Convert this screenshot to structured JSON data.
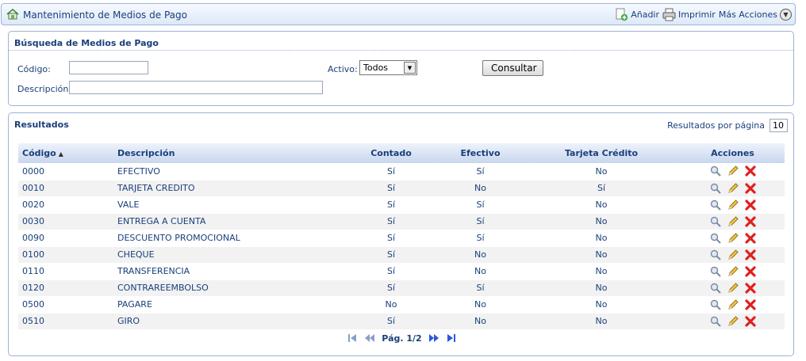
{
  "header": {
    "title": "Mantenimiento de Medios de Pago",
    "add_label": "Añadir",
    "print_label": "Imprimir",
    "more_label": "Más Acciones"
  },
  "search": {
    "title": "Búsqueda de Medios de Pago",
    "codigo_label": "Código:",
    "codigo_value": "",
    "descripcion_label": "Descripción:",
    "descripcion_value": "",
    "activo_label": "Activo:",
    "activo_value": "Todos",
    "submit_label": "Consultar"
  },
  "results": {
    "title": "Resultados",
    "per_page_label": "Resultados por página",
    "per_page_value": "10",
    "columns": {
      "codigo": "Código",
      "descripcion": "Descripción",
      "contado": "Contado",
      "efectivo": "Efectivo",
      "tarjeta": "Tarjeta Crédito",
      "acciones": "Acciones"
    },
    "rows": [
      [
        "0000",
        "EFECTIVO",
        "Sí",
        "Sí",
        "No"
      ],
      [
        "0010",
        "TARJETA CREDITO",
        "Sí",
        "No",
        "Sí"
      ],
      [
        "0020",
        "VALE",
        "Sí",
        "Sí",
        "No"
      ],
      [
        "0030",
        "ENTREGA A CUENTA",
        "Sí",
        "Sí",
        "No"
      ],
      [
        "0090",
        "DESCUENTO PROMOCIONAL",
        "Sí",
        "Sí",
        "No"
      ],
      [
        "0100",
        "CHEQUE",
        "Sí",
        "No",
        "No"
      ],
      [
        "0110",
        "TRANSFERENCIA",
        "Sí",
        "No",
        "No"
      ],
      [
        "0120",
        "CONTRAREEMBOLSO",
        "Sí",
        "Sí",
        "No"
      ],
      [
        "0500",
        "PAGARE",
        "No",
        "No",
        "No"
      ],
      [
        "0510",
        "GIRO",
        "Sí",
        "No",
        "No"
      ]
    ],
    "pager_label": "Pág. 1/2"
  },
  "colors": {
    "text": "#1a3f7a",
    "border": "#9db3d8",
    "delete": "#e02020"
  },
  "icons": {
    "app": "house-doc-icon",
    "add": "add-doc-icon",
    "print": "printer-icon",
    "more": "chevron-down-circle-icon",
    "view": "magnifier-icon",
    "edit": "pencil-icon",
    "delete": "red-x-icon"
  }
}
